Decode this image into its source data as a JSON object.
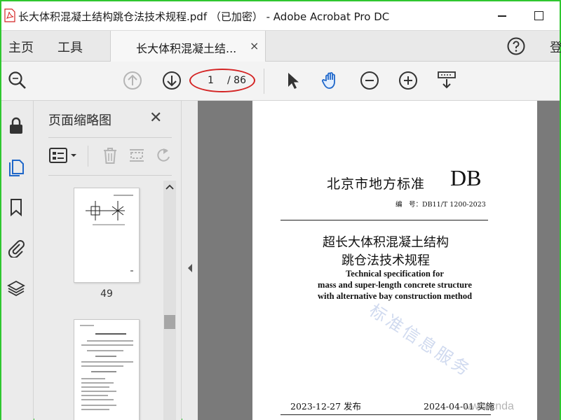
{
  "window": {
    "title": "长大体积混凝土结构跳仓法技术规程.pdf （已加密） - Adobe Acrobat Pro DC",
    "accent_color": "#d42424"
  },
  "menubar": {
    "home": "主页",
    "tools": "工具",
    "doc_tab": "长大体积混凝土结...",
    "doc_tab_close": "×",
    "login": "登"
  },
  "toolbar": {
    "page_current": "1",
    "page_total": "/ 86"
  },
  "thumb_panel": {
    "title": "页面缩略图",
    "close": "✕",
    "pages": [
      {
        "label": "49"
      },
      {
        "label": ""
      }
    ]
  },
  "document": {
    "standard_name": "北京市地方标准",
    "standard_code": "DB",
    "standard_number": "编　号：DB11/T 1200-2023",
    "cn_title_line1": "超长大体积混凝土结构",
    "cn_title_line2": "跳仓法技术规程",
    "en_title_line1": "Technical specification for",
    "en_title_line2": "mass and super-length concrete structure",
    "en_title_line3": "with alternative bay construction method",
    "issue_date": "2023-12-27 发布",
    "implement_date": "2024-04-01 实施",
    "watermark": "标准信息服务",
    "watermark_url": "www.cnda"
  }
}
